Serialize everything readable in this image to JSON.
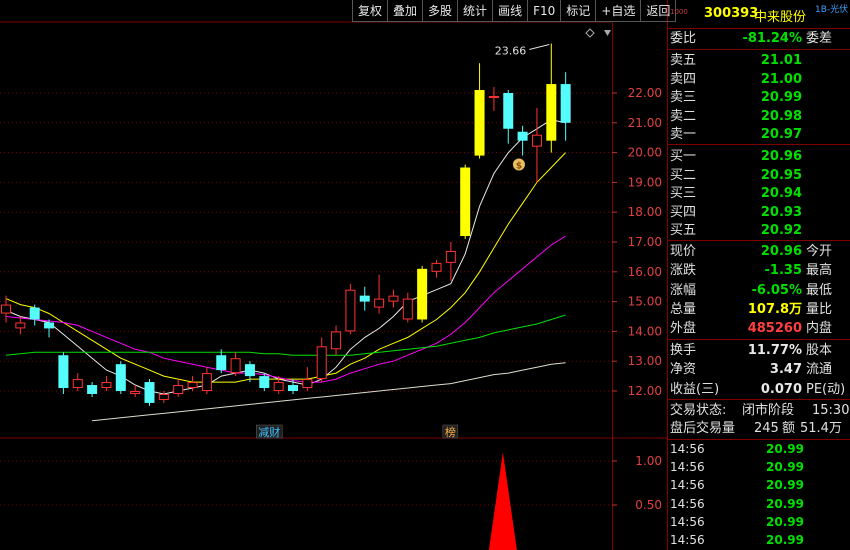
{
  "toolbar": [
    "复权",
    "叠加",
    "多股",
    "统计",
    "画线",
    "F10",
    "标记",
    "+自选",
    "返回"
  ],
  "stock": {
    "code": "300393",
    "name": "中来股份",
    "tag": "1B-光伏",
    "vert_tag": "1000"
  },
  "chart_data": {
    "type": "candlestick",
    "title": "",
    "price_axis": {
      "min": 11.5,
      "max": 22.6,
      "ticks": [
        12.0,
        13.0,
        14.0,
        15.0,
        16.0,
        17.0,
        18.0,
        19.0,
        20.0,
        21.0,
        22.0
      ]
    },
    "high_annotation": "23.66",
    "candles": [
      {
        "o": 14.6,
        "c": 14.9,
        "h": 15.2,
        "l": 14.3
      },
      {
        "o": 14.1,
        "c": 14.3,
        "h": 14.5,
        "l": 13.9
      },
      {
        "o": 14.8,
        "c": 14.4,
        "h": 14.9,
        "l": 14.2
      },
      {
        "o": 14.3,
        "c": 14.1,
        "h": 14.4,
        "l": 13.8
      },
      {
        "o": 13.2,
        "c": 12.1,
        "h": 13.3,
        "l": 11.9
      },
      {
        "o": 12.1,
        "c": 12.4,
        "h": 12.6,
        "l": 12.0
      },
      {
        "o": 12.2,
        "c": 11.9,
        "h": 12.3,
        "l": 11.8
      },
      {
        "o": 12.1,
        "c": 12.3,
        "h": 12.5,
        "l": 12.0
      },
      {
        "o": 12.9,
        "c": 12.0,
        "h": 13.0,
        "l": 11.9
      },
      {
        "o": 11.9,
        "c": 12.0,
        "h": 12.2,
        "l": 11.8
      },
      {
        "o": 12.3,
        "c": 11.6,
        "h": 12.4,
        "l": 11.5
      },
      {
        "o": 11.7,
        "c": 11.9,
        "h": 12.0,
        "l": 11.6
      },
      {
        "o": 11.9,
        "c": 12.2,
        "h": 12.4,
        "l": 11.8
      },
      {
        "o": 12.1,
        "c": 12.3,
        "h": 12.5,
        "l": 12.0
      },
      {
        "o": 12.0,
        "c": 12.6,
        "h": 12.8,
        "l": 11.9
      },
      {
        "o": 13.2,
        "c": 12.7,
        "h": 13.4,
        "l": 12.6
      },
      {
        "o": 12.6,
        "c": 13.1,
        "h": 13.3,
        "l": 12.5
      },
      {
        "o": 12.9,
        "c": 12.5,
        "h": 13.0,
        "l": 12.3
      },
      {
        "o": 12.5,
        "c": 12.1,
        "h": 12.6,
        "l": 12.0
      },
      {
        "o": 12.0,
        "c": 12.3,
        "h": 12.5,
        "l": 11.9
      },
      {
        "o": 12.2,
        "c": 12.0,
        "h": 12.4,
        "l": 11.9
      },
      {
        "o": 12.1,
        "c": 12.4,
        "h": 12.8,
        "l": 12.0
      },
      {
        "o": 12.4,
        "c": 13.5,
        "h": 13.8,
        "l": 12.3
      },
      {
        "o": 13.4,
        "c": 14.0,
        "h": 14.2,
        "l": 13.2
      },
      {
        "o": 14.0,
        "c": 15.4,
        "h": 15.6,
        "l": 13.9
      },
      {
        "o": 15.2,
        "c": 15.0,
        "h": 15.5,
        "l": 14.7
      },
      {
        "o": 14.8,
        "c": 15.1,
        "h": 15.9,
        "l": 14.6
      },
      {
        "o": 15.0,
        "c": 15.2,
        "h": 15.4,
        "l": 14.8
      },
      {
        "o": 14.4,
        "c": 15.1,
        "h": 15.3,
        "l": 14.3
      },
      {
        "o": 14.4,
        "c": 16.1,
        "h": 16.2,
        "l": 14.3
      },
      {
        "o": 16.0,
        "c": 16.3,
        "h": 16.4,
        "l": 15.8
      },
      {
        "o": 16.3,
        "c": 16.7,
        "h": 17.0,
        "l": 15.7
      },
      {
        "o": 17.2,
        "c": 19.5,
        "h": 19.6,
        "l": 17.1
      },
      {
        "o": 19.9,
        "c": 22.1,
        "h": 23.0,
        "l": 19.8
      },
      {
        "o": 21.9,
        "c": 21.9,
        "h": 22.2,
        "l": 21.4
      },
      {
        "o": 22.0,
        "c": 20.8,
        "h": 22.1,
        "l": 20.3
      },
      {
        "o": 20.7,
        "c": 20.4,
        "h": 20.9,
        "l": 19.9
      },
      {
        "o": 20.2,
        "c": 20.6,
        "h": 21.5,
        "l": 19.0
      },
      {
        "o": 20.4,
        "c": 22.3,
        "h": 23.66,
        "l": 20.0
      },
      {
        "o": 22.3,
        "c": 21.0,
        "h": 22.7,
        "l": 20.4
      }
    ],
    "ma_lines": [
      {
        "name": "MA5",
        "color": "#e8e8e8",
        "values": [
          14.7,
          14.5,
          14.4,
          14.3,
          13.9,
          13.5,
          13.1,
          12.7,
          12.5,
          12.2,
          12.0,
          11.9,
          12.0,
          12.1,
          12.2,
          12.5,
          12.6,
          12.7,
          12.6,
          12.4,
          12.3,
          12.2,
          12.4,
          12.8,
          13.4,
          13.8,
          14.1,
          14.5,
          15.0,
          15.2,
          15.4,
          15.6,
          16.6,
          18.2,
          19.3,
          20.0,
          20.5,
          20.8,
          21.1,
          21.0
        ]
      },
      {
        "name": "MA10",
        "color": "#ffff00",
        "values": [
          15.1,
          14.9,
          14.8,
          14.6,
          14.3,
          14.0,
          13.7,
          13.4,
          13.1,
          12.9,
          12.7,
          12.5,
          12.4,
          12.3,
          12.3,
          12.3,
          12.3,
          12.4,
          12.4,
          12.4,
          12.4,
          12.4,
          12.5,
          12.6,
          12.9,
          13.1,
          13.4,
          13.6,
          13.8,
          14.1,
          14.4,
          14.8,
          15.3,
          16.0,
          16.8,
          17.6,
          18.3,
          19.0,
          19.5,
          20.0
        ]
      },
      {
        "name": "MA20",
        "color": "#ff00ff",
        "values": [
          14.5,
          14.45,
          14.4,
          14.35,
          14.3,
          14.2,
          14.0,
          13.8,
          13.6,
          13.4,
          13.3,
          13.1,
          13.0,
          12.9,
          12.8,
          12.7,
          12.6,
          12.6,
          12.55,
          12.45,
          12.35,
          12.3,
          12.3,
          12.4,
          12.6,
          12.75,
          12.9,
          13.0,
          13.2,
          13.4,
          13.6,
          13.9,
          14.3,
          14.8,
          15.3,
          15.7,
          16.1,
          16.5,
          16.9,
          17.2
        ]
      },
      {
        "name": "MA60",
        "color": "#00e000",
        "values": [
          13.2,
          13.25,
          13.3,
          13.3,
          13.3,
          13.3,
          13.3,
          13.3,
          13.3,
          13.3,
          13.3,
          13.3,
          13.3,
          13.3,
          13.3,
          13.3,
          13.3,
          13.3,
          13.25,
          13.25,
          13.2,
          13.2,
          13.2,
          13.2,
          13.2,
          13.25,
          13.3,
          13.35,
          13.4,
          13.45,
          13.5,
          13.6,
          13.7,
          13.8,
          13.95,
          14.05,
          14.15,
          14.25,
          14.4,
          14.55
        ]
      },
      {
        "name": "MA250",
        "color": "#ddddcc",
        "values": [
          null,
          null,
          null,
          null,
          null,
          null,
          11.0,
          11.05,
          11.1,
          11.15,
          11.2,
          11.25,
          11.3,
          11.35,
          11.4,
          11.45,
          11.5,
          11.55,
          11.6,
          11.65,
          11.7,
          11.75,
          11.8,
          11.85,
          11.9,
          11.95,
          12.0,
          12.05,
          12.1,
          12.15,
          12.2,
          12.25,
          12.35,
          12.45,
          12.55,
          12.6,
          12.7,
          12.8,
          12.9,
          12.95
        ]
      }
    ],
    "event_labels": [
      {
        "text": "减财",
        "index": 18
      },
      {
        "text": "榜",
        "index": 31
      }
    ],
    "indicator": {
      "ticks": [
        1.0,
        0.5
      ],
      "ylim": [
        0,
        1.3
      ],
      "spike_index": 34,
      "spike_value": 1.1
    }
  },
  "quote": {
    "weibi": {
      "label": "委比",
      "value": "-81.24%",
      "label2": "委差"
    },
    "sell": [
      {
        "label": "卖五",
        "price": "21.01"
      },
      {
        "label": "卖四",
        "price": "21.00"
      },
      {
        "label": "卖三",
        "price": "20.99"
      },
      {
        "label": "卖二",
        "price": "20.98"
      },
      {
        "label": "卖一",
        "price": "20.97"
      }
    ],
    "buy": [
      {
        "label": "买一",
        "price": "20.96"
      },
      {
        "label": "买二",
        "price": "20.95"
      },
      {
        "label": "买三",
        "price": "20.94"
      },
      {
        "label": "买四",
        "price": "20.93"
      },
      {
        "label": "买五",
        "price": "20.92"
      }
    ],
    "stats": [
      {
        "label": "现价",
        "value": "20.96",
        "label2": "今开",
        "color": "green"
      },
      {
        "label": "涨跌",
        "value": "-1.35",
        "label2": "最高",
        "color": "green"
      },
      {
        "label": "涨幅",
        "value": "-6.05%",
        "label2": "最低",
        "color": "green"
      },
      {
        "label": "总量",
        "value": "107.8万",
        "label2": "量比",
        "color": "yellow"
      },
      {
        "label": "外盘",
        "value": "485260",
        "label2": "内盘",
        "color": "red"
      }
    ],
    "stats2": [
      {
        "label": "换手",
        "value": "11.77%",
        "label2": "股本",
        "color": "white"
      },
      {
        "label": "净资",
        "value": "3.47",
        "label2": "流通",
        "color": "white"
      },
      {
        "label": "收益(三)",
        "value": "0.070",
        "label2": "PE(动)",
        "color": "white"
      }
    ],
    "trade_status": {
      "label": "交易状态:",
      "value": "闭市阶段",
      "time": "15:30:"
    },
    "after_hours": {
      "label": "盘后交易量",
      "vol": "245",
      "amt_label": "额",
      "amt": "51.4万"
    },
    "ticks": [
      {
        "time": "14:56",
        "price": "20.99"
      },
      {
        "time": "14:56",
        "price": "20.99"
      },
      {
        "time": "14:56",
        "price": "20.99"
      },
      {
        "time": "14:56",
        "price": "20.99"
      },
      {
        "time": "14:56",
        "price": "20.99"
      },
      {
        "time": "14:56",
        "price": "20.99"
      }
    ]
  }
}
